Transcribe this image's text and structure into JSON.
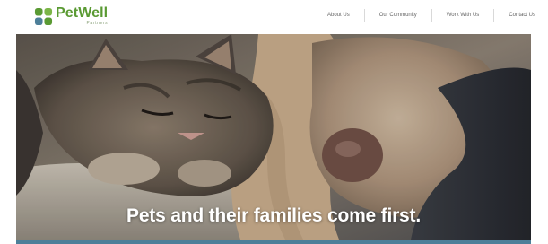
{
  "brand": {
    "name": "PetWell",
    "tagline": "Partners",
    "color": "#5a9a33"
  },
  "nav": {
    "items": [
      {
        "label": "About Us"
      },
      {
        "label": "Our Community"
      },
      {
        "label": "Work With Us"
      },
      {
        "label": "Contact Us"
      }
    ]
  },
  "hero": {
    "headline": "Pets and their families come first.",
    "image": "kitten-and-dog-sleeping"
  },
  "colors": {
    "accent": "#4d7f99",
    "nav_text": "#666666"
  }
}
